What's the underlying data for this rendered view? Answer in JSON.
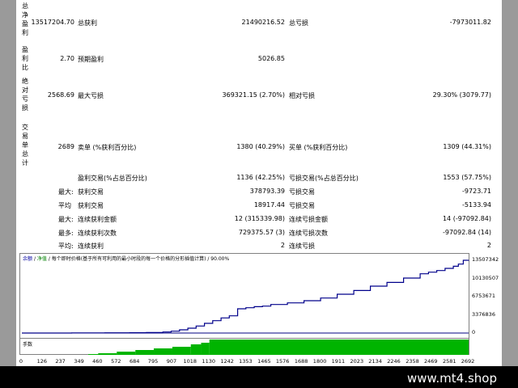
{
  "side_labels": {
    "net_profit": "总净盈利",
    "profit_factor": "盈利比",
    "absolute_drawdown": "绝对亏损",
    "total_trades": "交易单总计"
  },
  "stats": {
    "net_profit_value": "13517204.70",
    "gross_profit_label": "总获利",
    "gross_profit_value": "21490216.52",
    "gross_loss_label": "总亏损",
    "gross_loss_value": "-7973011.82",
    "profit_factor_value": "2.70",
    "expected_payoff_label": "预期盈利",
    "expected_payoff_value": "5026.85",
    "absolute_drawdown_value": "2568.69",
    "maximal_drawdown_label": "最大亏损",
    "maximal_drawdown_value": "369321.15 (2.70%)",
    "relative_drawdown_label": "相对亏损",
    "relative_drawdown_value": "29.30% (3079.77)",
    "total_trades_value": "2689",
    "short_label": "卖单 (%获利百分比)",
    "short_value": "1380 (40.29%)",
    "long_label": "买单 (%获利百分比)",
    "long_value": "1309 (44.31%)",
    "profit_trades_label": "盈利交易(%占总百分比)",
    "profit_trades_value": "1136 (42.25%)",
    "loss_trades_label": "亏损交易(%占总百分比)",
    "loss_trades_value": "1553 (57.75%)",
    "largest_prefix": "最大:",
    "largest_profit_label": "获利交易",
    "largest_profit_value": "378793.39",
    "largest_loss_label": "亏损交易",
    "largest_loss_value": "-9723.71",
    "average_prefix": "平均",
    "average_profit_label": "获利交易",
    "average_profit_value": "18917.44",
    "average_loss_label": "亏损交易",
    "average_loss_value": "-5133.94",
    "max_prefix": "最大:",
    "max_consec_wins_label": "连续获利金额",
    "max_consec_wins_value": "12 (315339.98)",
    "max_consec_losses_label": "连续亏损金额",
    "max_consec_losses_value": "14 (-97092.84)",
    "maximal_prefix": "最多:",
    "maximal_consec_profit_label": "连续获利次数",
    "maximal_consec_profit_value": "729375.57 (3)",
    "maximal_consec_loss_label": "连续亏损次数",
    "maximal_consec_loss_value": "-97092.84 (14)",
    "avg_prefix": "平均:",
    "avg_consec_wins_label": "连续获利",
    "avg_consec_wins_value": "2",
    "avg_consec_losses_label": "连续亏损",
    "avg_consec_losses_value": "2"
  },
  "chart": {
    "legend_balance": "余额",
    "legend_sep": "/",
    "legend_equity": "净值",
    "legend_rest": "/ 每个即时价格(基于所有可利用的最小时段的每一个价格的分形插值计算) / 90.00%",
    "volume_label": "手数",
    "colors": {
      "balance": "#00008b",
      "volume": "#00b400",
      "axis": "#808080"
    }
  },
  "chart_data": {
    "type": "line",
    "ylim": [
      0,
      13507342
    ],
    "yticks": [
      "13507342",
      "10130507",
      "6753671",
      "3376836",
      "0"
    ],
    "xticks": [
      "0",
      "126",
      "237",
      "349",
      "460",
      "572",
      "684",
      "795",
      "907",
      "1018",
      "1130",
      "1242",
      "1353",
      "1465",
      "1576",
      "1688",
      "1800",
      "1911",
      "2023",
      "2134",
      "2246",
      "2358",
      "2469",
      "2581",
      "2692"
    ],
    "x": [
      0,
      100,
      300,
      500,
      650,
      750,
      850,
      900,
      950,
      1000,
      1050,
      1100,
      1150,
      1200,
      1250,
      1300,
      1350,
      1400,
      1450,
      1500,
      1600,
      1700,
      1800,
      1900,
      2000,
      2100,
      2200,
      2300,
      2400,
      2450,
      2500,
      2550,
      2600,
      2630,
      2660,
      2692
    ],
    "series": [
      {
        "values": [
          0,
          2568,
          15000,
          40000,
          60000,
          90000,
          200000,
          350000,
          600000,
          900000,
          1300000,
          1800000,
          2300000,
          2800000,
          3200000,
          4500000,
          4700000,
          4900000,
          5000000,
          5300000,
          5600000,
          6000000,
          6500000,
          7200000,
          7900000,
          8700000,
          9400000,
          10200000,
          11000000,
          11300000,
          11600000,
          12000000,
          12400000,
          12800000,
          13500000,
          13517204
        ]
      }
    ],
    "volume_level": 1.0
  },
  "footer": {
    "brand": "www.mt4.shop"
  }
}
